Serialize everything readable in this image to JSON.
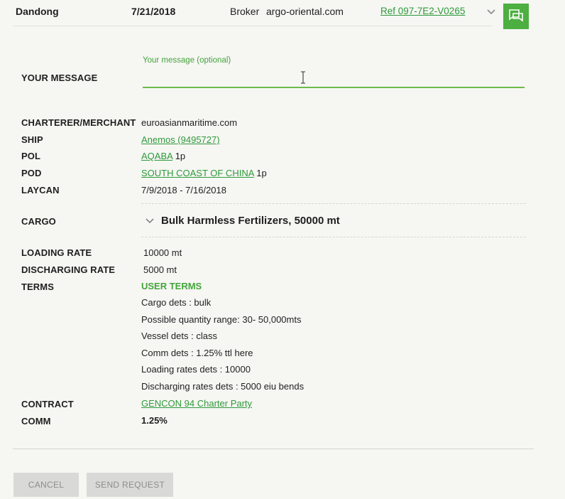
{
  "header": {
    "port": "Dandong",
    "date": "7/21/2018",
    "broker_label": "Broker",
    "broker_value": "argo-oriental.com",
    "ref": "Ref 097-7E2-V0265"
  },
  "message": {
    "label": "YOUR MESSAGE",
    "placeholder": "Your message (optional)"
  },
  "details": {
    "charterer_label": "CHARTERER/MERCHANT",
    "charterer_value": "euroasianmaritime.com",
    "ship_label": "SHIP",
    "ship_value": "Anemos (9495727)",
    "pol_label": "POL",
    "pol_value": "AQABA",
    "pol_suffix": "1p",
    "pod_label": "POD",
    "pod_value": "SOUTH COAST OF CHINA",
    "pod_suffix": "1p",
    "laycan_label": "LAYCAN",
    "laycan_value": "7/9/2018 - 7/16/2018",
    "cargo_label": "CARGO",
    "cargo_value": "Bulk Harmless Fertilizers, 50000 mt",
    "loading_rate_label": "LOADING RATE",
    "loading_rate_value": "10000 mt",
    "discharging_rate_label": "DISCHARGING RATE",
    "discharging_rate_value": "5000 mt",
    "terms_label": "TERMS",
    "terms_heading": "USER TERMS",
    "terms_lines": [
      "Cargo dets : bulk",
      "Possible quantity range: 30- 50,000mts",
      "Vessel dets : class",
      "Comm dets : 1.25% ttl here",
      "Loading rates dets : 10000",
      "Discharging rates dets : 5000 eiu bends"
    ],
    "contract_label": "CONTRACT",
    "contract_value": "GENCON 94 Charter Party",
    "comm_label": "COMM",
    "comm_value": "1.25%"
  },
  "actions": {
    "cancel_label": "CANCEL",
    "send_label": "SEND REQUEST"
  },
  "colors": {
    "accent": "#43a53b",
    "link": "#2e9a3a",
    "button_bg": "#d9d9d7"
  }
}
